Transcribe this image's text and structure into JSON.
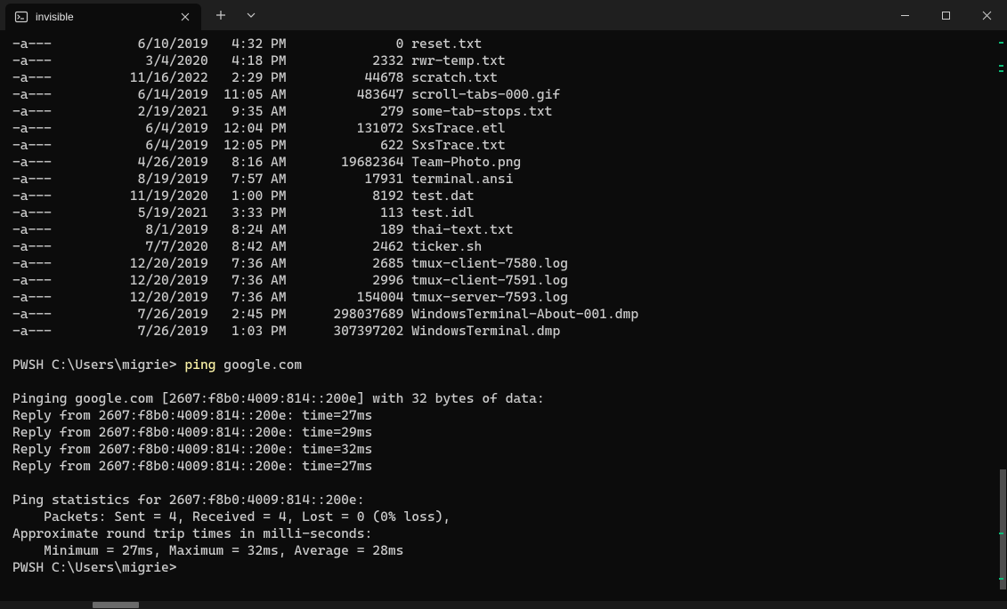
{
  "titlebar": {
    "tab_title": "invisible",
    "new_tab_tooltip": "New Tab",
    "dropdown_tooltip": "New Tab Dropdown"
  },
  "dir_listing": [
    {
      "mode": "-a---",
      "date": "6/10/2019",
      "time": "4:32 PM",
      "size": "0",
      "name": "reset.txt"
    },
    {
      "mode": "-a---",
      "date": "3/4/2020",
      "time": "4:18 PM",
      "size": "2332",
      "name": "rwr-temp.txt"
    },
    {
      "mode": "-a---",
      "date": "11/16/2022",
      "time": "2:29 PM",
      "size": "44678",
      "name": "scratch.txt"
    },
    {
      "mode": "-a---",
      "date": "6/14/2019",
      "time": "11:05 AM",
      "size": "483647",
      "name": "scroll-tabs-000.gif"
    },
    {
      "mode": "-a---",
      "date": "2/19/2021",
      "time": "9:35 AM",
      "size": "279",
      "name": "some-tab-stops.txt"
    },
    {
      "mode": "-a---",
      "date": "6/4/2019",
      "time": "12:04 PM",
      "size": "131072",
      "name": "SxsTrace.etl"
    },
    {
      "mode": "-a---",
      "date": "6/4/2019",
      "time": "12:05 PM",
      "size": "622",
      "name": "SxsTrace.txt"
    },
    {
      "mode": "-a---",
      "date": "4/26/2019",
      "time": "8:16 AM",
      "size": "19682364",
      "name": "Team-Photo.png"
    },
    {
      "mode": "-a---",
      "date": "8/19/2019",
      "time": "7:57 AM",
      "size": "17931",
      "name": "terminal.ansi"
    },
    {
      "mode": "-a---",
      "date": "11/19/2020",
      "time": "1:00 PM",
      "size": "8192",
      "name": "test.dat"
    },
    {
      "mode": "-a---",
      "date": "5/19/2021",
      "time": "3:33 PM",
      "size": "113",
      "name": "test.idl"
    },
    {
      "mode": "-a---",
      "date": "8/1/2019",
      "time": "8:24 AM",
      "size": "189",
      "name": "thai-text.txt"
    },
    {
      "mode": "-a---",
      "date": "7/7/2020",
      "time": "8:42 AM",
      "size": "2462",
      "name": "ticker.sh"
    },
    {
      "mode": "-a---",
      "date": "12/20/2019",
      "time": "7:36 AM",
      "size": "2685",
      "name": "tmux-client-7580.log"
    },
    {
      "mode": "-a---",
      "date": "12/20/2019",
      "time": "7:36 AM",
      "size": "2996",
      "name": "tmux-client-7591.log"
    },
    {
      "mode": "-a---",
      "date": "12/20/2019",
      "time": "7:36 AM",
      "size": "154004",
      "name": "tmux-server-7593.log"
    },
    {
      "mode": "-a---",
      "date": "7/26/2019",
      "time": "2:45 PM",
      "size": "298037689",
      "name": "WindowsTerminal-About-001.dmp"
    },
    {
      "mode": "-a---",
      "date": "7/26/2019",
      "time": "1:03 PM",
      "size": "307397202",
      "name": "WindowsTerminal.dmp"
    }
  ],
  "prompt1": {
    "prefix": "PWSH C:\\Users\\migrie> ",
    "cmd": "ping",
    "args": " google.com"
  },
  "ping_output": [
    "",
    "Pinging google.com [2607:f8b0:4009:814::200e] with 32 bytes of data:",
    "Reply from 2607:f8b0:4009:814::200e: time=27ms",
    "Reply from 2607:f8b0:4009:814::200e: time=29ms",
    "Reply from 2607:f8b0:4009:814::200e: time=32ms",
    "Reply from 2607:f8b0:4009:814::200e: time=27ms",
    "",
    "Ping statistics for 2607:f8b0:4009:814::200e:",
    "    Packets: Sent = 4, Received = 4, Lost = 0 (0% loss),",
    "Approximate round trip times in milli-seconds:",
    "    Minimum = 27ms, Maximum = 32ms, Average = 28ms"
  ],
  "prompt2": {
    "prefix": "PWSH C:\\Users\\migrie>"
  },
  "scrollbar": {
    "thumb_top_pct": 77,
    "thumb_height_pct": 21,
    "marks_pct": [
      2,
      6,
      7,
      88,
      96
    ]
  }
}
